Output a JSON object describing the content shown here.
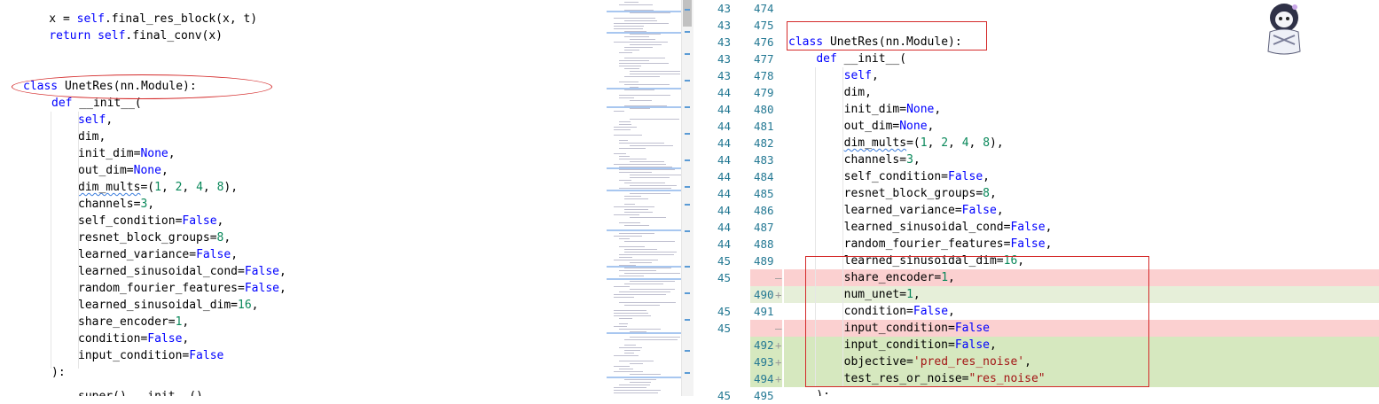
{
  "left_code": {
    "lines": [
      [
        "",
        "    x = ",
        "",
        "self",
        ".final_res_block(x, t)"
      ],
      [
        "",
        "    ",
        "return",
        " self",
        ".final_conv(x)"
      ],
      [
        "",
        "",
        "",
        "",
        ""
      ],
      [
        "",
        "",
        "",
        "",
        ""
      ],
      [
        "",
        "",
        "class",
        " UnetRes",
        "(nn.Module):"
      ],
      [
        "",
        "    ",
        "def",
        " __init__",
        "("
      ]
    ],
    "params": [
      "self,",
      "dim,",
      "init_dim=None,",
      "out_dim=None,",
      "dim_mults=(1, 2, 4, 8),",
      "channels=3,",
      "self_condition=False,",
      "resnet_block_groups=8,",
      "learned_variance=False,",
      "learned_sinusoidal_cond=False,",
      "random_fourier_features=False,",
      "learned_sinusoidal_dim=16,",
      "share_encoder=1,",
      "condition=False,",
      "input_condition=False"
    ],
    "close": "):",
    "super_line": "super().__init__()"
  },
  "right_code": {
    "rows": [
      {
        "orig": "43",
        "mod": "474",
        "marker": "",
        "text": ""
      },
      {
        "orig": "43",
        "mod": "475",
        "marker": "",
        "text": ""
      },
      {
        "orig": "43",
        "mod": "476",
        "marker": "",
        "text": "class UnetRes(nn.Module):"
      },
      {
        "orig": "43",
        "mod": "477",
        "marker": "",
        "text": "    def __init__("
      },
      {
        "orig": "43",
        "mod": "478",
        "marker": "",
        "text": "        self,"
      },
      {
        "orig": "44",
        "mod": "479",
        "marker": "",
        "text": "        dim,"
      },
      {
        "orig": "44",
        "mod": "480",
        "marker": "",
        "text": "        init_dim=None,"
      },
      {
        "orig": "44",
        "mod": "481",
        "marker": "",
        "text": "        out_dim=None,"
      },
      {
        "orig": "44",
        "mod": "482",
        "marker": "",
        "text": "        dim_mults=(1, 2, 4, 8),"
      },
      {
        "orig": "44",
        "mod": "483",
        "marker": "",
        "text": "        channels=3,"
      },
      {
        "orig": "44",
        "mod": "484",
        "marker": "",
        "text": "        self_condition=False,"
      },
      {
        "orig": "44",
        "mod": "485",
        "marker": "",
        "text": "        resnet_block_groups=8,"
      },
      {
        "orig": "44",
        "mod": "486",
        "marker": "",
        "text": "        learned_variance=False,"
      },
      {
        "orig": "44",
        "mod": "487",
        "marker": "",
        "text": "        learned_sinusoidal_cond=False,"
      },
      {
        "orig": "44",
        "mod": "488",
        "marker": "",
        "text": "        random_fourier_features=False,"
      },
      {
        "orig": "45",
        "mod": "489",
        "marker": "",
        "text": "        learned_sinusoidal_dim=16,"
      },
      {
        "orig": "45",
        "mod": "",
        "marker": "—",
        "text": "        share_encoder=1,"
      },
      {
        "orig": "",
        "mod": "490",
        "marker": "+",
        "text": "        num_unet=1,"
      },
      {
        "orig": "45",
        "mod": "491",
        "marker": "",
        "text": "        condition=False,"
      },
      {
        "orig": "45",
        "mod": "",
        "marker": "—",
        "text": "        input_condition=False"
      },
      {
        "orig": "",
        "mod": "492",
        "marker": "+",
        "text": "        input_condition=False,"
      },
      {
        "orig": "",
        "mod": "493",
        "marker": "+",
        "text": "        objective='pred_res_noise',"
      },
      {
        "orig": "",
        "mod": "494",
        "marker": "+",
        "text": "        test_res_or_noise=\"res_noise\""
      },
      {
        "orig": "45",
        "mod": "495",
        "marker": "",
        "text": "    ):"
      }
    ]
  },
  "colors": {
    "removed": "#fbd0d0",
    "added": "#e6efd9",
    "added_strong": "#d6e8bf",
    "annotation": "#d42a2a",
    "keyword": "#0000ff",
    "number": "#09885a",
    "string": "#a31515"
  }
}
